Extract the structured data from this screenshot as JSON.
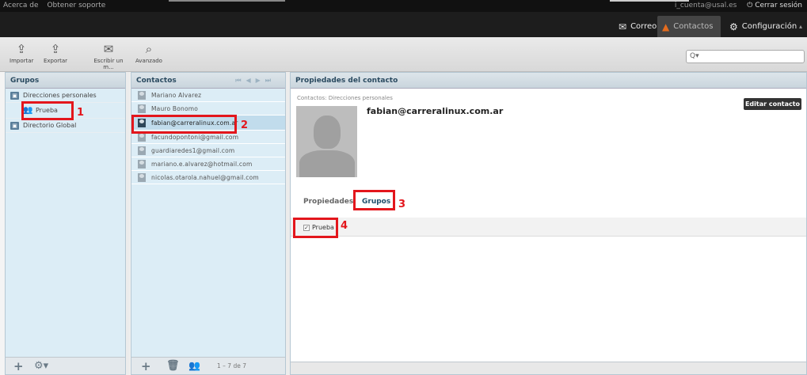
{
  "topbar": {
    "links": [
      "Acerca de",
      "Obtener soporte"
    ],
    "user": "i_cuenta@usal.es",
    "logout_label": "Cerrar sesión"
  },
  "nav": {
    "mail": "Correo",
    "contacts": "Contactos",
    "settings": "Configuración"
  },
  "toolbar": {
    "import": "Importar",
    "export": "Exportar",
    "compose": "Escribir un m...",
    "advanced": "Avanzado",
    "search_prefix": "Q▾"
  },
  "groups": {
    "title": "Grupos",
    "items": [
      {
        "label": "Direcciones personales"
      },
      {
        "label": "Prueba"
      },
      {
        "label": "Directorio Global"
      }
    ]
  },
  "contacts": {
    "title": "Contactos",
    "count": "1 – 7 de 7",
    "items": [
      {
        "label": "Mariano Alvarez"
      },
      {
        "label": "Mauro Bonomo"
      },
      {
        "label": "fabian@carreralinux.com.ar"
      },
      {
        "label": "facundopontoni@gmail.com"
      },
      {
        "label": "guardiaredes1@gmail.com"
      },
      {
        "label": "mariano.e.alvarez@hotmail.com"
      },
      {
        "label": "nicolas.otarola.nahuel@gmail.com"
      }
    ]
  },
  "props": {
    "title": "Propiedades del contacto",
    "breadcrumb": "Contactos: Direcciones personales",
    "name": "fabian@carreralinux.com.ar",
    "edit_button": "Editar contacto",
    "tabs": [
      "Propiedades",
      "Grupos"
    ],
    "group_checkbox_label": "Prueba"
  },
  "annotations": [
    "1",
    "2",
    "3",
    "4"
  ],
  "colors": {
    "annotation": "#e3161c",
    "selected_row": "#c1dcec",
    "panel_bg": "#dcedf6"
  }
}
